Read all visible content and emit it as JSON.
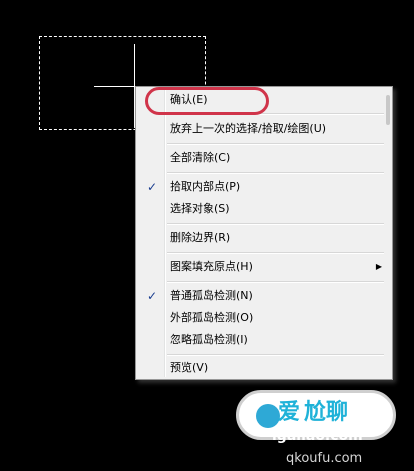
{
  "context_menu": {
    "items": [
      {
        "label": "确认(E)",
        "checked": false
      },
      {
        "label": "放弃上一次的选择/拾取/绘图(U)",
        "checked": false
      },
      {
        "label": "全部清除(C)",
        "checked": false
      },
      {
        "label": "拾取内部点(P)",
        "checked": true
      },
      {
        "label": "选择对象(S)",
        "checked": false
      },
      {
        "label": "删除边界(R)",
        "checked": false
      },
      {
        "label": "图案填充原点(H)",
        "checked": false,
        "submenu": true
      },
      {
        "label": "普通孤岛检测(N)",
        "checked": true
      },
      {
        "label": "外部孤岛检测(O)",
        "checked": false
      },
      {
        "label": "忽略孤岛检测(I)",
        "checked": false
      },
      {
        "label": "预览(V)",
        "checked": false
      }
    ],
    "check_glyph": "✓",
    "submenu_glyph": "▶"
  },
  "watermark": {
    "brand": "爱",
    "brand_tail": "尬聊",
    "domain": "igaliao.com",
    "footer": "qkoufu.com"
  },
  "colors": {
    "background": "#000000",
    "highlight_oval": "#d0344a",
    "menu_bg": "#f0f0f0",
    "check": "#1a3d8f"
  }
}
